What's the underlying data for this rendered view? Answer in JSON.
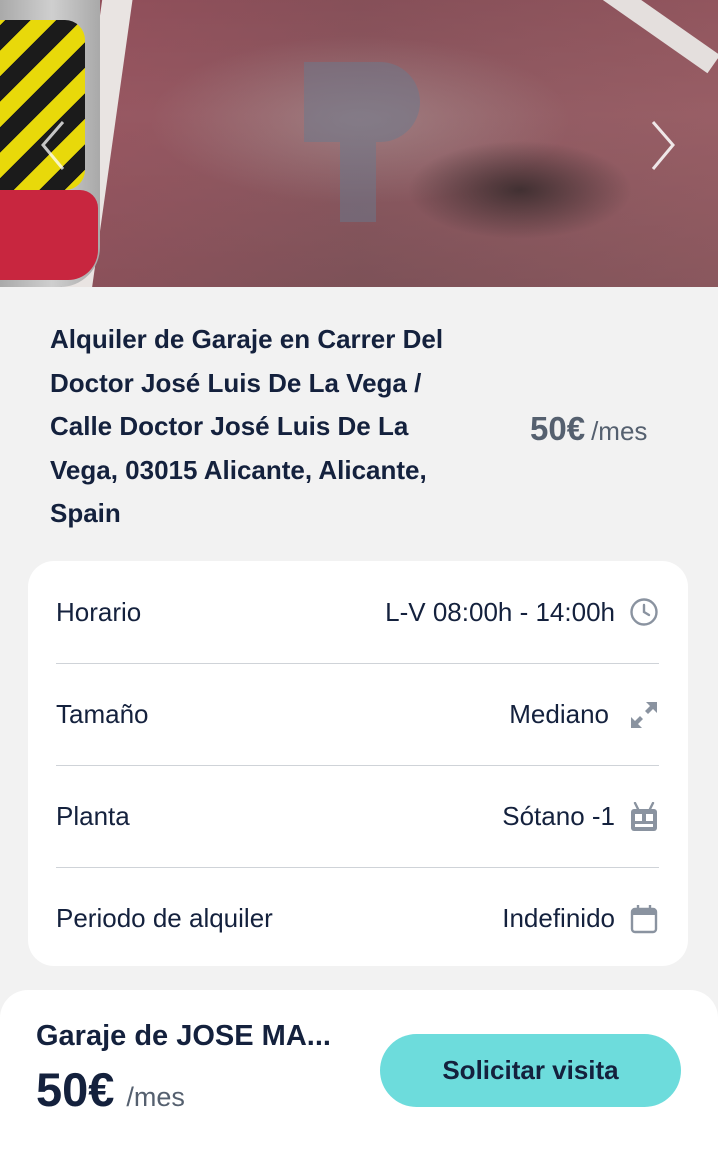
{
  "listing": {
    "title": "Alquiler de Garaje en Carrer Del Doctor José Luis De La Vega / Calle Doctor José Luis De La Vega, 03015 Alicante, Alicante, Spain",
    "price": "50€",
    "price_unit": "/mes"
  },
  "details": [
    {
      "label": "Horario",
      "value": "L-V 08:00h - 14:00h",
      "icon": "clock-icon"
    },
    {
      "label": "Tamaño",
      "value": "Mediano",
      "icon": "expand-icon"
    },
    {
      "label": "Planta",
      "value": "Sótano -1",
      "icon": "floor-icon"
    },
    {
      "label": "Periodo de alquiler",
      "value": "Indefinido",
      "icon": "calendar-icon"
    }
  ],
  "footer": {
    "name": "Garaje de JOSE MA...",
    "price": "50€",
    "price_unit": "/mes",
    "cta_label": "Solicitar visita"
  },
  "colors": {
    "accent": "#6ddcdc",
    "text": "#14213d",
    "muted": "#55606f",
    "background": "#f2f2f2"
  }
}
